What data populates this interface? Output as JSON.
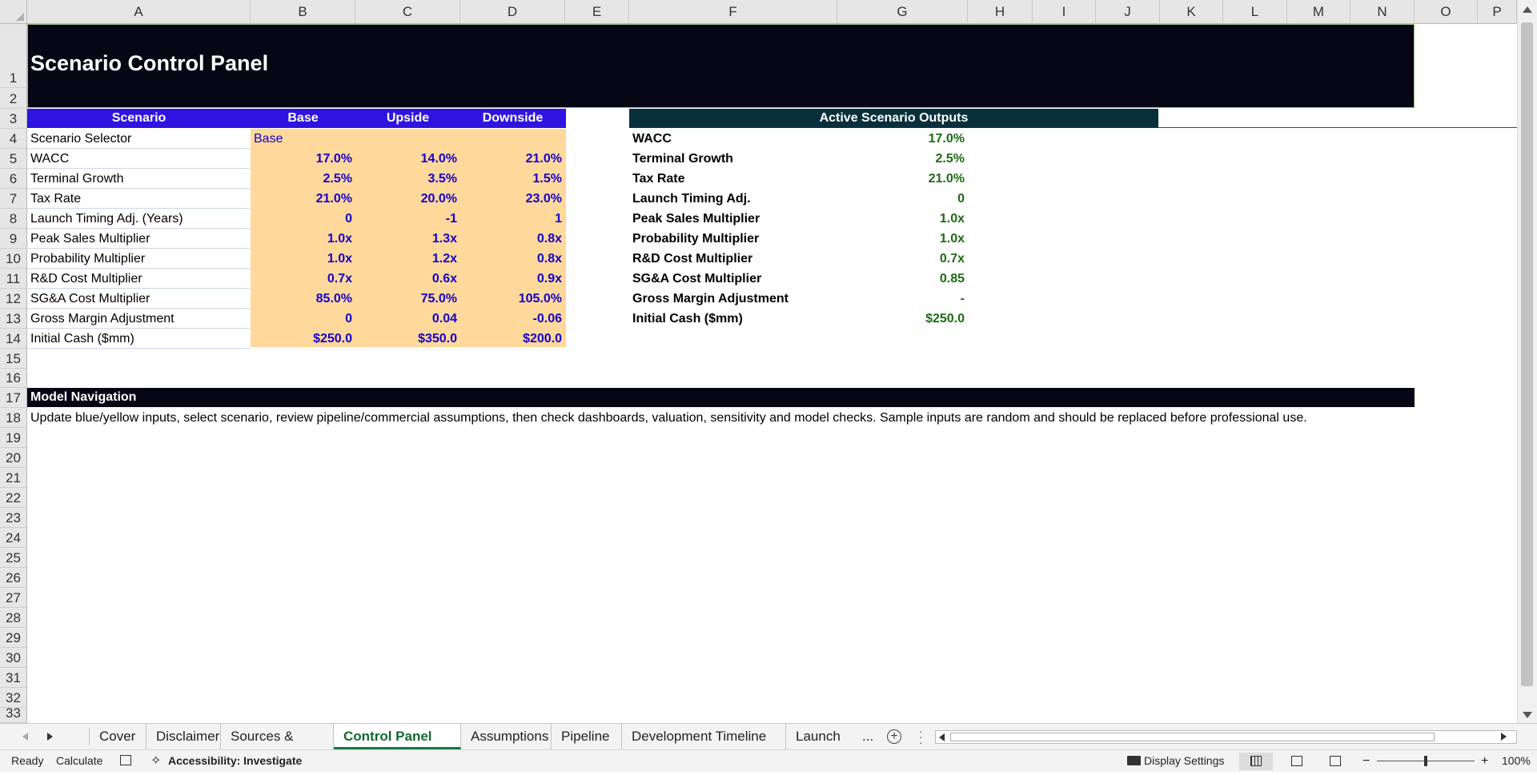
{
  "columns": [
    "A",
    "B",
    "C",
    "D",
    "E",
    "F",
    "G",
    "H",
    "I",
    "J",
    "K",
    "L",
    "M",
    "N",
    "O",
    "P"
  ],
  "rows": [
    "1",
    "2",
    "3",
    "4",
    "5",
    "6",
    "7",
    "8",
    "9",
    "10",
    "11",
    "12",
    "13",
    "14",
    "15",
    "16",
    "17",
    "18",
    "19",
    "20",
    "21",
    "22",
    "23",
    "24",
    "25",
    "26",
    "27",
    "28",
    "29",
    "30",
    "31",
    "32",
    "33"
  ],
  "title": "Scenario Control Panel",
  "scenario_table": {
    "headers": [
      "Scenario",
      "Base",
      "Upside",
      "Downside"
    ],
    "rows": [
      {
        "label": "Scenario Selector",
        "base": "Base",
        "upside": "",
        "downside": ""
      },
      {
        "label": "WACC",
        "base": "17.0%",
        "upside": "14.0%",
        "downside": "21.0%"
      },
      {
        "label": "Terminal Growth",
        "base": "2.5%",
        "upside": "3.5%",
        "downside": "1.5%"
      },
      {
        "label": "Tax Rate",
        "base": "21.0%",
        "upside": "20.0%",
        "downside": "23.0%"
      },
      {
        "label": "Launch Timing Adj. (Years)",
        "base": "0",
        "upside": "-1",
        "downside": "1"
      },
      {
        "label": "Peak Sales Multiplier",
        "base": "1.0x",
        "upside": "1.3x",
        "downside": "0.8x"
      },
      {
        "label": "Probability Multiplier",
        "base": "1.0x",
        "upside": "1.2x",
        "downside": "0.8x"
      },
      {
        "label": "R&D Cost Multiplier",
        "base": "0.7x",
        "upside": "0.6x",
        "downside": "0.9x"
      },
      {
        "label": "SG&A Cost Multiplier",
        "base": "85.0%",
        "upside": "75.0%",
        "downside": "105.0%"
      },
      {
        "label": "Gross Margin Adjustment",
        "base": "0",
        "upside": "0.04",
        "downside": "-0.06"
      },
      {
        "label": "Initial Cash ($mm)",
        "base": "$250.0",
        "upside": "$350.0",
        "downside": "$200.0"
      }
    ]
  },
  "outputs": {
    "header": "Active Scenario Outputs",
    "rows": [
      {
        "label": "WACC",
        "value": "17.0%"
      },
      {
        "label": "Terminal Growth",
        "value": "2.5%"
      },
      {
        "label": "Tax Rate",
        "value": "21.0%"
      },
      {
        "label": "Launch Timing Adj.",
        "value": "0"
      },
      {
        "label": "Peak Sales Multiplier",
        "value": "1.0x"
      },
      {
        "label": "Probability Multiplier",
        "value": "1.0x"
      },
      {
        "label": "R&D Cost Multiplier",
        "value": "0.7x"
      },
      {
        "label": "SG&A Cost Multiplier",
        "value": "0.85"
      },
      {
        "label": "Gross Margin Adjustment",
        "value": "-"
      },
      {
        "label": "Initial Cash ($mm)",
        "value": "$250.0"
      }
    ]
  },
  "navigation": {
    "header": "Model Navigation",
    "text": "Update blue/yellow inputs, select scenario, review pipeline/commercial assumptions, then check dashboards, valuation, sensitivity and model checks. Sample inputs are random and should be replaced before professional use."
  },
  "tabs": [
    "Cover",
    "Disclaimer",
    "Sources & Notes",
    "Control Panel",
    "Assumptions",
    "Pipeline",
    "Development Timeline",
    "Launch"
  ],
  "active_tab": "Control Panel",
  "tab_overflow": "...",
  "status": {
    "ready": "Ready",
    "calculate": "Calculate",
    "accessibility": "Accessibility: Investigate",
    "display_settings": "Display Settings",
    "zoom_minus": "−",
    "zoom_plus": "+",
    "zoom": "100%"
  },
  "colors": {
    "title_bg": "#060615",
    "table_header_bg": "#2f14e0",
    "outputs_header_bg": "#082f3c",
    "nav_header_bg": "#060615",
    "input_bg": "#ffd89b",
    "input_text": "#1400c8",
    "output_value": "#1d6b12",
    "accent": "#107c41"
  },
  "zoom_level": 0.5
}
